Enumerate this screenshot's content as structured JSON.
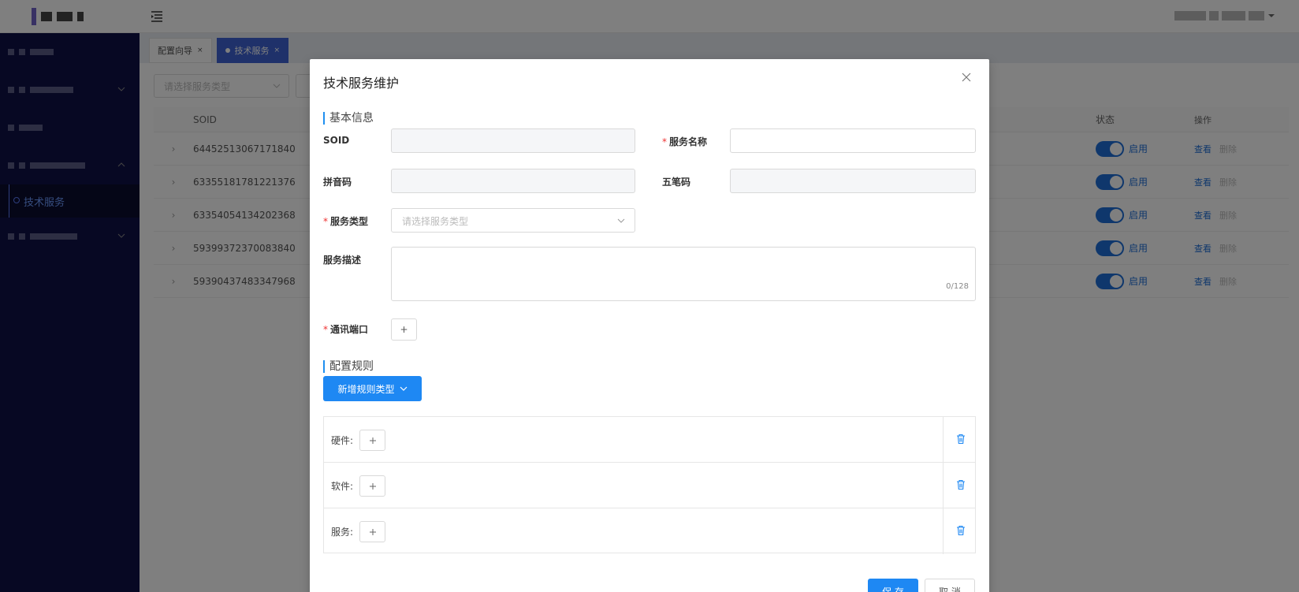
{
  "header": {
    "menu_toggle_icon": "menu-fold-icon"
  },
  "sidebar": {
    "active_sub_item": "技术服务"
  },
  "tabs": [
    {
      "label": "配置向导"
    },
    {
      "label": "技术服务"
    }
  ],
  "filter": {
    "service_type_placeholder": "请选择服务类型"
  },
  "table": {
    "headers": {
      "soid": "SOID",
      "status": "状态",
      "operation": "操作"
    },
    "rows": [
      {
        "soid": "64452513067171840",
        "status": "启用",
        "view": "查看",
        "delete": "删除"
      },
      {
        "soid": "63355181781221376",
        "status": "启用",
        "view": "查看",
        "delete": "删除"
      },
      {
        "soid": "63354054134202368",
        "status": "启用",
        "view": "查看",
        "delete": "删除"
      },
      {
        "soid": "59399372370083840",
        "status": "启用",
        "view": "查看",
        "delete": "删除"
      },
      {
        "soid": "59390437483347968",
        "status": "启用",
        "view": "查看",
        "delete": "删除"
      }
    ]
  },
  "modal": {
    "title": "技术服务维护",
    "section_basic": "基本信息",
    "fields": {
      "soid_label": "SOID",
      "service_name_label": "服务名称",
      "pinyin_label": "拼音码",
      "wubi_label": "五笔码",
      "service_type_label": "服务类型",
      "service_type_placeholder": "请选择服务类型",
      "description_label": "服务描述",
      "description_count": "0/128",
      "port_label": "通讯端口",
      "port_add": "+"
    },
    "section_rules": "配置规则",
    "add_rule_type_button": "新增规则类型",
    "rules": [
      {
        "label": "硬件:"
      },
      {
        "label": "软件:"
      },
      {
        "label": "服务:"
      }
    ],
    "save_button": "保 存",
    "cancel_button": "取 消"
  },
  "colors": {
    "primary": "#1e88f3",
    "sidebar_bg": "#0f1146",
    "required": "#e33333"
  }
}
